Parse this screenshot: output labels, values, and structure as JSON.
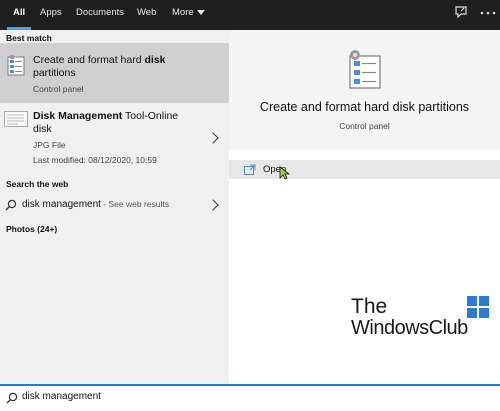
{
  "tabs": [
    {
      "label": "All",
      "active": true
    },
    {
      "label": "Apps"
    },
    {
      "label": "Documents"
    },
    {
      "label": "Web"
    },
    {
      "label": "More"
    }
  ],
  "left": {
    "best_match_header": "Best match",
    "best_match": {
      "title_prefix": "Create and format hard ",
      "title_bold": "disk",
      "title_line2": "partitions",
      "subtitle": "Control panel"
    },
    "second_result": {
      "title_bold": "Disk Management",
      "title_rest": " Tool-Online",
      "title_line2": "disk",
      "type": "JPG File",
      "modified": "Last modified: 08/12/2020, 10:59"
    },
    "search_web_header": "Search the web",
    "web_result": {
      "query": "disk management",
      "suffix": " - See web results"
    },
    "photos_header": "Photos (24+)"
  },
  "right": {
    "title": "Create and format hard disk partitions",
    "subtitle": "Control panel",
    "open_label": "Open"
  },
  "watermark": {
    "line1": "The",
    "line2": "WindowsClub"
  },
  "search": {
    "value": "disk management"
  },
  "colors": {
    "accent": "#4aa0e6",
    "topbar": "#1f1f1f",
    "selected": "#cfcfcf"
  }
}
